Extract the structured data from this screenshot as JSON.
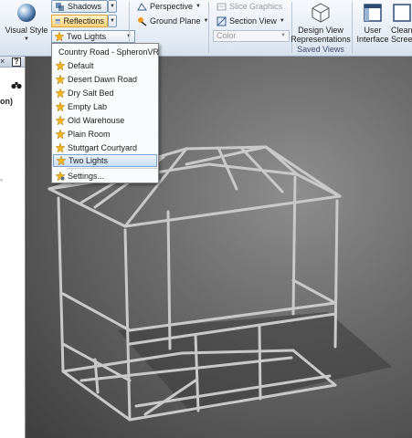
{
  "ribbon": {
    "visual_style_label": "Visual Style",
    "shadows_label": "Shadows",
    "reflections_label": "Reflections",
    "lighting_current": "Two Lights",
    "perspective_label": "Perspective",
    "ground_plane_label": "Ground Plane",
    "slice_graphics_label": "Slice Graphics",
    "section_view_label": "Section View",
    "color_value": "Color",
    "design_view_label_1": "Design View",
    "design_view_label_2": "Representations",
    "saved_views_group": "Saved Views",
    "user_interface_label_1": "User",
    "user_interface_label_2": "Interface",
    "clean_screen_label_1": "Clean",
    "clean_screen_label_2": "Screen"
  },
  "lighting_dropdown": {
    "items": [
      {
        "label": "Country Road - SpheronVR",
        "icon": "lighting-style-icon"
      },
      {
        "label": "Default",
        "icon": "lighting-style-icon"
      },
      {
        "label": "Desert Dawn Road",
        "icon": "lighting-style-icon"
      },
      {
        "label": "Dry Salt Bed",
        "icon": "lighting-style-icon"
      },
      {
        "label": "Empty Lab",
        "icon": "lighting-style-icon"
      },
      {
        "label": "Old Warehouse",
        "icon": "lighting-style-icon"
      },
      {
        "label": "Plain Room",
        "icon": "lighting-style-icon"
      },
      {
        "label": "Stuttgart Courtyard",
        "icon": "lighting-style-icon"
      },
      {
        "label": "Two Lights",
        "icon": "lighting-style-icon",
        "selected": true
      }
    ],
    "settings_label": "Settings..."
  },
  "browser_panel": {
    "close_glyph": "×",
    "help_glyph": "?",
    "row_text": "on)"
  },
  "colors": {
    "accent_active": "#ffd37a",
    "selection": "#c9ddf5",
    "viewport_bg": "#6c6c6c"
  }
}
